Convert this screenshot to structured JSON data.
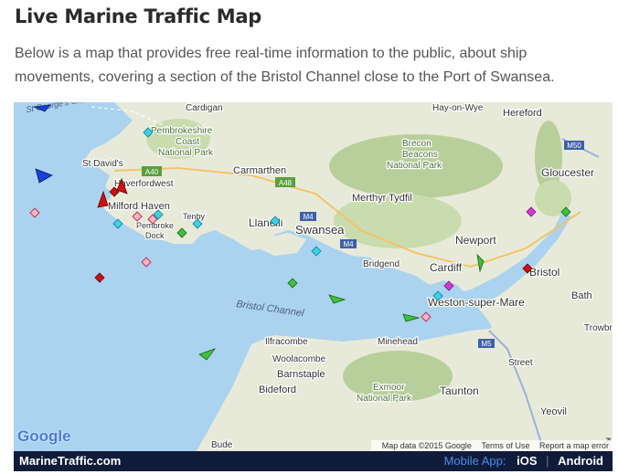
{
  "page": {
    "title": "Live Marine Traffic Map",
    "intro": "Below is a map that provides free real-time information to the public, about ship movements, covering a section of the Bristol Channel close to the Port of Swansea."
  },
  "map": {
    "places": [
      "Cardigan",
      "Hay-on-Wye",
      "Hereford",
      "Pembrokeshire",
      "Coast",
      "National Park",
      "Brecon",
      "Beacons",
      "National Park",
      "St David's",
      "Carmarthen",
      "Gloucester",
      "Haverfordwest",
      "Milford Haven",
      "Merthyr Tydfil",
      "Tenby",
      "Pembroke",
      "Dock",
      "Llanelli",
      "Swansea",
      "Newport",
      "Bristol",
      "Bridgend",
      "Cardiff",
      "Weston-super-Mare",
      "Bath",
      "Trowbr",
      "Bristol Channel",
      "Ilfracombe",
      "Woolacombe",
      "Minehead",
      "Barnstaple",
      "Street",
      "Bideford",
      "Exmoor",
      "National Park",
      "Taunton",
      "Yeovil",
      "Bude",
      "St George's Chan"
    ],
    "roads": [
      "A40",
      "A48",
      "M4",
      "M4",
      "M50",
      "M5"
    ],
    "google_logo": "Google",
    "attribution": [
      "Map data ©2015 Google",
      "Terms of Use",
      "Report a map error"
    ],
    "colors": {
      "sea": "#abd3f0",
      "land": "#e8ead9",
      "forest": "#c9dcae",
      "park_hills": "#b8cf9b"
    }
  },
  "footer": {
    "brand": "MarineTraffic.com",
    "mobile_label": "Mobile App:",
    "ios": "iOS",
    "separator": "|",
    "android": "Android"
  }
}
